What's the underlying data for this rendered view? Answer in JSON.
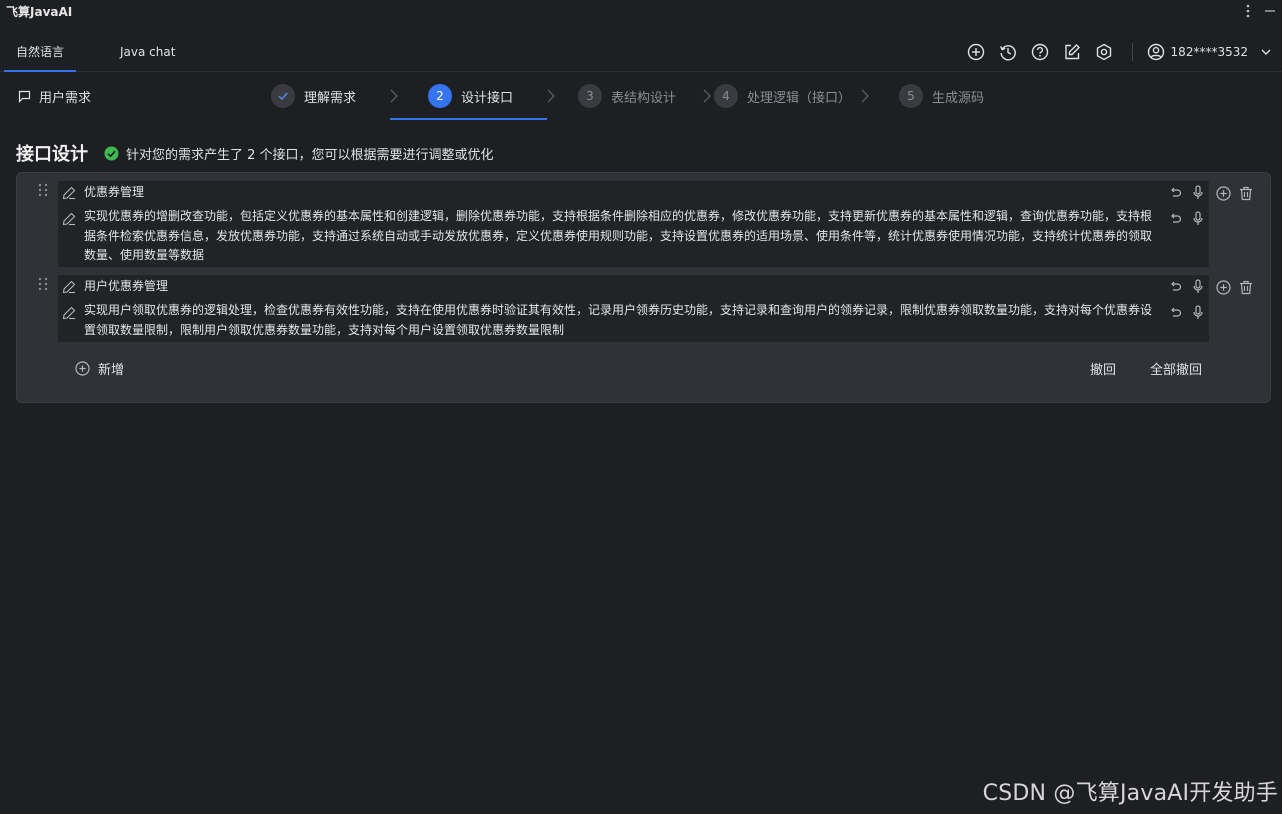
{
  "app": {
    "title": "飞算JavaAI"
  },
  "tabs": [
    {
      "label": "自然语言",
      "active": true
    },
    {
      "label": "Java chat",
      "active": false
    }
  ],
  "toolbar": {
    "icons": [
      "add-circle-icon",
      "history-icon",
      "help-icon",
      "edit-note-icon",
      "settings-icon"
    ],
    "user_label": "182****3532"
  },
  "requirement": {
    "label": "用户需求"
  },
  "steps": [
    {
      "number": "1",
      "label": "理解需求",
      "state": "done"
    },
    {
      "number": "2",
      "label": "设计接口",
      "state": "active"
    },
    {
      "number": "3",
      "label": "表结构设计",
      "state": "pending"
    },
    {
      "number": "4",
      "label": "处理逻辑（接口）",
      "state": "pending"
    },
    {
      "number": "5",
      "label": "生成源码",
      "state": "pending"
    }
  ],
  "section": {
    "title": "接口设计",
    "message": "针对您的需求产生了 2 个接口，您可以根据需要进行调整或优化"
  },
  "interfaces": [
    {
      "name": "优惠券管理",
      "description": "实现优惠券的增删改查功能，包括定义优惠券的基本属性和创建逻辑，删除优惠券功能，支持根据条件删除相应的优惠券，修改优惠券功能，支持更新优惠券的基本属性和逻辑，查询优惠券功能，支持根据条件检索优惠券信息，发放优惠券功能，支持通过系统自动或手动发放优惠券，定义优惠券使用规则功能，支持设置优惠券的适用场景、使用条件等，统计优惠券使用情况功能，支持统计优惠券的领取数量、使用数量等数据",
      "desc_lines": [
        "实现优惠券的增删改查功能，包括定义优惠券的基本属性和创建逻辑，删除优惠券功能，支持根据条件删除相应的优惠券，修改优惠券功能，支持更新优惠券的基本属性和逻辑，查询优惠券功能，支持根",
        "据条件检索优惠券信息，发放优惠券功能，支持通过系统自动或手动发放优惠券，定义优惠券使用规则功能，支持设置优惠券的适用场景、使用条件等，统计优惠券使用情况功能，支持统计优惠券的领取",
        "数量、使用数量等数据"
      ]
    },
    {
      "name": "用户优惠券管理",
      "description": "实现用户领取优惠券的逻辑处理，检查优惠券有效性功能，支持在使用优惠券时验证其有效性，记录用户领券历史功能，支持记录和查询用户的领券记录，限制优惠券领取数量功能，支持对每个优惠券设置领取数量限制，限制用户领取优惠券数量功能，支持对每个用户设置领取优惠券数量限制",
      "desc_lines": [
        "实现用户领取优惠券的逻辑处理，检查优惠券有效性功能，支持在使用优惠券时验证其有效性，记录用户领券历史功能，支持记录和查询用户的领券记录，限制优惠券领取数量功能，支持对每个优惠券设",
        "置领取数量限制，限制用户领取优惠券数量功能，支持对每个用户设置领取优惠券数量限制"
      ]
    }
  ],
  "actions": {
    "add_label": "新增",
    "undo_label": "撤回",
    "undo_all_label": "全部撤回"
  },
  "watermark": "CSDN @飞算JavaAI开发助手",
  "colors": {
    "background": "#1e1f22",
    "panel": "#2f3237",
    "item": "#212327",
    "accent": "#3574f0",
    "success": "#3fb950"
  }
}
